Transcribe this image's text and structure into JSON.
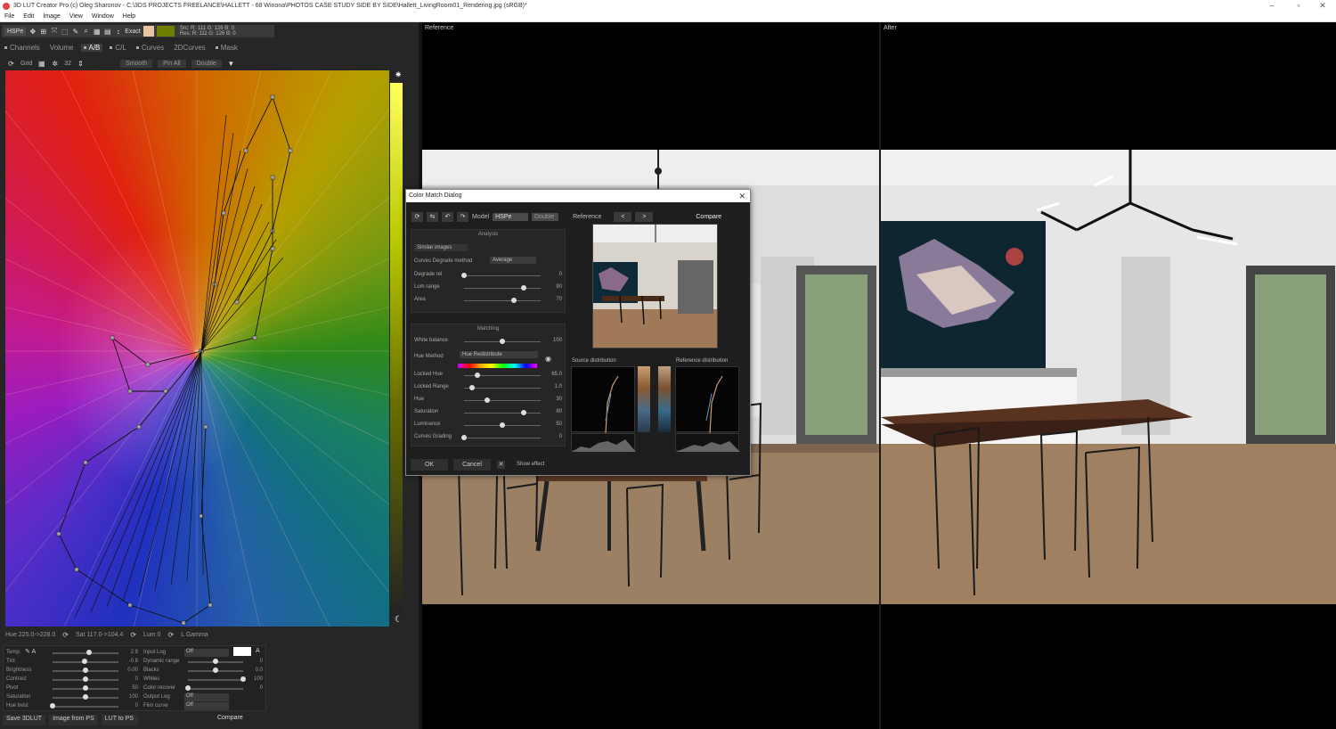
{
  "window": {
    "title": "3D LUT Creator Pro (c) Oleg Sharonov - C:\\3DS PROJECTS FREELANCE\\HALLETT - 68 Winona\\PHOTOS CASE STUDY SIDE BY SIDE\\Hallett_LivingRoom01_Rendering.jpg (sRGB)*",
    "minimize": "–",
    "maximize": "▫",
    "close": "✕"
  },
  "menu": [
    "File",
    "Edit",
    "Image",
    "View",
    "Window",
    "Help"
  ],
  "toolbar": {
    "model": "HSPe",
    "exact_label": "Exact",
    "src_line": "Src: R: 111  G: 126  B: 0",
    "res_line": "Res: R: 111  G: 126  B: 0",
    "src_color": "#e8c4a2",
    "res_color": "#6f7e00"
  },
  "tabs": [
    "Channels",
    "Volume",
    "A/B",
    "C/L",
    "Curves",
    "2DCurves",
    "Mask"
  ],
  "active_tab": "A/B",
  "grid": {
    "grid_label": "Grid",
    "grid_size": "32",
    "smooth": "Smooth",
    "pin_all": "Pin All",
    "double": "Double"
  },
  "status": {
    "hue": "Hue 225.0->228.0",
    "sat": "Sat 117.0->104.4",
    "lum": "Lum  0",
    "curve": "L  Gamma"
  },
  "adjust_left": [
    {
      "label": "Temp.",
      "value": "2.9",
      "pos": 0.55
    },
    {
      "label": "Tint",
      "value": "-0.8",
      "pos": 0.48
    },
    {
      "label": "Brightness",
      "value": "0.00",
      "pos": 0.5
    },
    {
      "label": "Contrast",
      "value": "0",
      "pos": 0.5
    },
    {
      "label": "Pivot",
      "value": "50",
      "pos": 0.5
    },
    {
      "label": "Saturation",
      "value": "100",
      "pos": 0.5
    },
    {
      "label": "Hue twist",
      "value": "0",
      "pos": 0.0
    }
  ],
  "adjust_left_auto": "A",
  "adjust_right": [
    {
      "label": "Input Log",
      "value": "Off",
      "kind": "dropdown"
    },
    {
      "label": "Dynamic range",
      "value": "0",
      "pos": 0.5
    },
    {
      "label": "Blacks",
      "value": "0.0",
      "pos": 0.5
    },
    {
      "label": "Whites",
      "value": "100",
      "pos": 1.0
    },
    {
      "label": "Color recover",
      "value": "0",
      "pos": 0.0
    },
    {
      "label": "Output Log",
      "value": "Off",
      "kind": "dropdown"
    },
    {
      "label": "Film curve",
      "value": "Off",
      "kind": "dropdown"
    }
  ],
  "adjust_right_auto": "A",
  "bottom_buttons": [
    "Save 3DLUT",
    "Image from PS",
    "LUT to PS"
  ],
  "compare_label": "Compare",
  "panes": {
    "reference": "Reference",
    "after": "After"
  },
  "dialog": {
    "title": "Color Match Dialog",
    "model_label": "Model",
    "model": "HSPe",
    "double": "Double",
    "reference_label": "Reference",
    "prev": "<",
    "next": ">",
    "compare": "Compare",
    "analysis_title": "Analysis",
    "similar_images": "Similar images",
    "degrade_method_label": "Curves Degrade method",
    "degrade_method": "Average",
    "analysis_sliders": [
      {
        "label": "Degrade rel",
        "value": "0",
        "pos": 0.0
      },
      {
        "label": "Lum range",
        "value": "90",
        "pos": 0.78
      },
      {
        "label": "Area",
        "value": "70",
        "pos": 0.65
      }
    ],
    "matching_title": "Matching",
    "white_balance": {
      "label": "White balance",
      "value": "100",
      "pos": 0.5
    },
    "hue_method_label": "Hue Method",
    "hue_method": "Hue Redistribute",
    "matching_sliders": [
      {
        "label": "Locked Hue",
        "value": "65.0",
        "pos": 0.18
      },
      {
        "label": "Locked Range",
        "value": "1.0",
        "pos": 0.1
      },
      {
        "label": "Hue",
        "value": "30",
        "pos": 0.3
      },
      {
        "label": "Saturation",
        "value": "80",
        "pos": 0.78
      },
      {
        "label": "Luminance",
        "value": "50",
        "pos": 0.5
      },
      {
        "label": "Curves Grading",
        "value": "0",
        "pos": 0.0
      }
    ],
    "source_distribution": "Source distribution",
    "reference_distribution": "Reference distribution",
    "ok": "OK",
    "cancel": "Cancel",
    "show_effect": "Show effect"
  }
}
